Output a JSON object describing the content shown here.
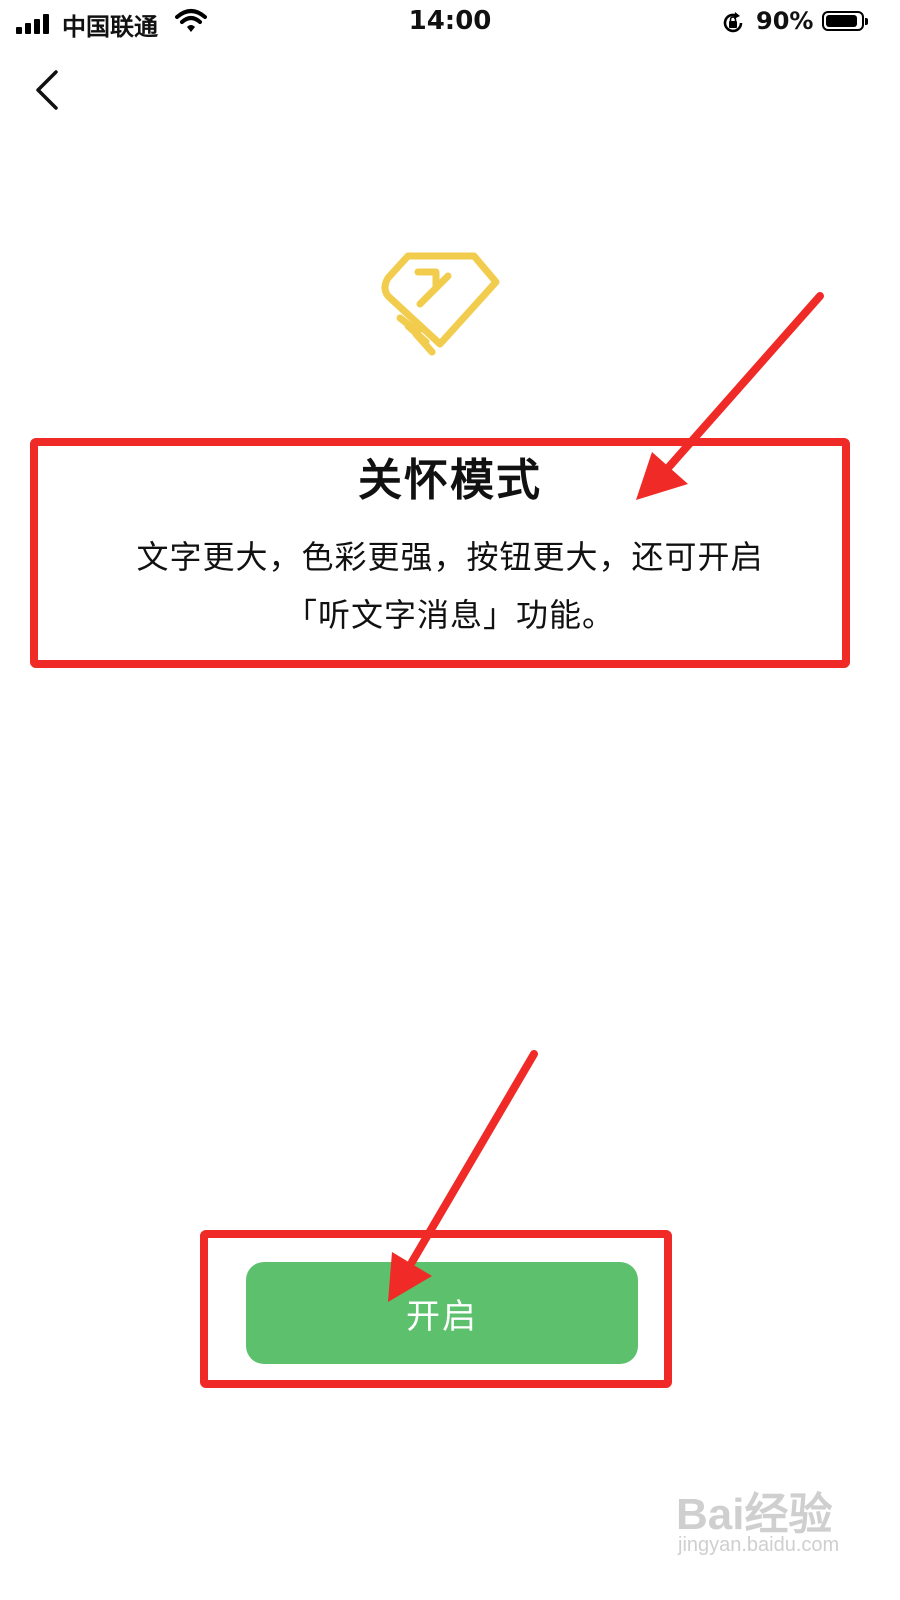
{
  "status_bar": {
    "carrier": "中国联通",
    "time": "14:00",
    "battery": "90%",
    "battery_level": 0.9,
    "icons": [
      "signal-icon",
      "wifi-icon",
      "rotation-lock-icon",
      "battery-icon"
    ]
  },
  "nav": {
    "back_icon": "chevron-left-icon"
  },
  "content": {
    "icon": "care-hands-icon",
    "title": "关怀模式",
    "description_line1": "文字更大，色彩更强，按钮更大，还可开启",
    "description_line2": "「听文字消息」功能。"
  },
  "actions": {
    "enable_label": "开启"
  },
  "colors": {
    "primary_button": "#5cc06d",
    "icon_accent": "#f2cc4d",
    "annotation": "#f02a26"
  },
  "watermark": {
    "brand": "Bai经验",
    "url": "jingyan.baidu.com"
  }
}
